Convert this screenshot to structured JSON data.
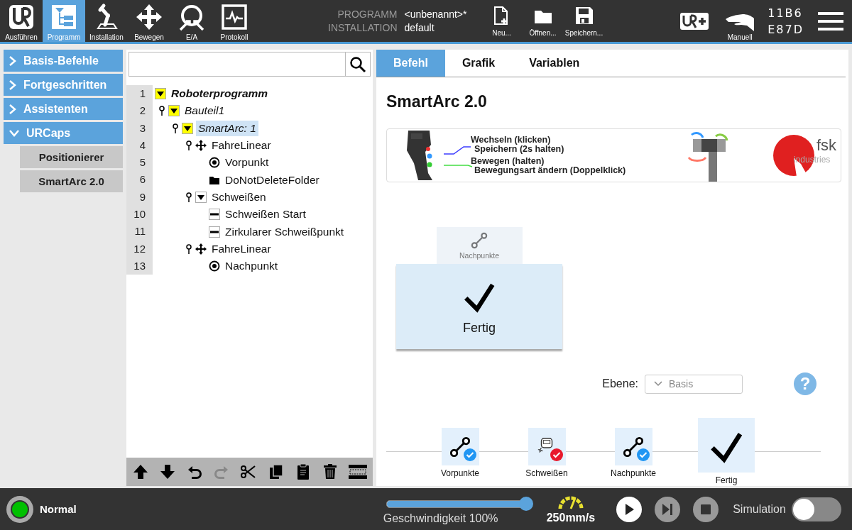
{
  "top_bar": {
    "nav": [
      {
        "label": "Ausführen",
        "kind": "logo",
        "selected": false
      },
      {
        "label": "Programm",
        "kind": "program",
        "selected": true
      },
      {
        "label": "Installation",
        "kind": "robot",
        "selected": false
      },
      {
        "label": "Bewegen",
        "kind": "move",
        "selected": false
      },
      {
        "label": "E/A",
        "kind": "io",
        "selected": false
      },
      {
        "label": "Protokoll",
        "kind": "log",
        "selected": false
      }
    ],
    "info": [
      {
        "label": "PROGRAMM",
        "value": "<unbenannt>*"
      },
      {
        "label": "INSTALLATION",
        "value": "default"
      }
    ],
    "file_buttons": [
      {
        "label": "Neu...",
        "kind": "new"
      },
      {
        "label": "Öffnen...",
        "kind": "open"
      },
      {
        "label": "Speichern...",
        "kind": "save"
      }
    ],
    "mode": "Manuell",
    "serial": [
      "11B6",
      "E87D"
    ]
  },
  "sidebar": {
    "items": [
      {
        "label": "Basis-Befehle",
        "expanded": false
      },
      {
        "label": "Fortgeschritten",
        "expanded": false
      },
      {
        "label": "Assistenten",
        "expanded": false
      },
      {
        "label": "URCaps",
        "expanded": true,
        "children": [
          {
            "label": "Positionierer"
          },
          {
            "label": "SmartArc 2.0"
          }
        ]
      }
    ]
  },
  "tree": {
    "nodes": [
      {
        "line": "1",
        "label": "Roboterprogramm",
        "kind": "program",
        "selected": false,
        "children": [
          {
            "line": "2",
            "label": "Bauteil1",
            "kind": "subprogram",
            "selected": false,
            "children": [
              {
                "line": "3",
                "label": "SmartArc: 1",
                "kind": "subprogram",
                "selected": true,
                "children": [
                  {
                    "line": "4",
                    "label": "FahreLinear",
                    "kind": "move",
                    "selected": false,
                    "children": [
                      {
                        "line": "5",
                        "label": "Vorpunkt",
                        "kind": "waypoint",
                        "selected": false
                      },
                      {
                        "line": "6",
                        "label": "DoNotDeleteFolder",
                        "kind": "folder",
                        "selected": false
                      }
                    ]
                  },
                  {
                    "line": "9",
                    "label": "Schweißen",
                    "kind": "group",
                    "selected": false,
                    "children": [
                      {
                        "line": "10",
                        "label": "Schweißen Start",
                        "kind": "action",
                        "selected": false
                      },
                      {
                        "line": "11",
                        "label": "Zirkularer Schweißpunkt",
                        "kind": "action",
                        "selected": false
                      }
                    ]
                  },
                  {
                    "line": "12",
                    "label": "FahreLinear",
                    "kind": "move",
                    "selected": false,
                    "children": [
                      {
                        "line": "13",
                        "label": "Nachpunkt",
                        "kind": "waypoint",
                        "selected": false
                      }
                    ]
                  }
                ]
              }
            ]
          }
        ]
      }
    ]
  },
  "command_panel": {
    "tabs": [
      {
        "label": "Befehl",
        "selected": true
      },
      {
        "label": "Grafik",
        "selected": false
      },
      {
        "label": "Variablen",
        "selected": false
      }
    ],
    "title": "SmartArc 2.0",
    "banner": {
      "callouts": [
        {
          "color": "#3c3cff",
          "lines": [
            "Wechseln (klicken)",
            "Speichern (2s halten)"
          ]
        },
        {
          "color": "#44dd44",
          "lines": [
            "Bewegen (halten)",
            "Bewegungsart ändern (Doppelklick)"
          ]
        }
      ],
      "logo": [
        "fsk",
        "industries"
      ]
    },
    "step_cards": [
      {
        "label": "Nachpunkte",
        "kind": "points",
        "selected": false
      },
      {
        "label": "Fertig",
        "kind": "finish",
        "selected": true
      }
    ],
    "level_select": {
      "label": "Ebene:",
      "value": "Basis"
    },
    "help": "?",
    "steps": [
      {
        "label": "Vorpunkte",
        "kind": "points",
        "color": "#2196f3",
        "selected": false
      },
      {
        "label": "Schweißen",
        "kind": "weld",
        "color": "#e8192c",
        "selected": false
      },
      {
        "label": "Nachpunkte",
        "kind": "points",
        "color": "#2196f3",
        "selected": false
      },
      {
        "label": "Fertig",
        "kind": "finish",
        "selected": true
      }
    ]
  },
  "bottom_bar": {
    "status": {
      "label": "Normal",
      "color": "#00c000"
    },
    "speed": {
      "level": 1,
      "label": "Geschwindigkeit 100%"
    },
    "tcp_speed": "250mm/s",
    "controls": [
      {
        "kind": "play",
        "disabled": false
      },
      {
        "kind": "step",
        "disabled": true
      },
      {
        "kind": "stop",
        "disabled": true
      }
    ],
    "simulation": {
      "label": "Simulation",
      "on": false
    }
  }
}
